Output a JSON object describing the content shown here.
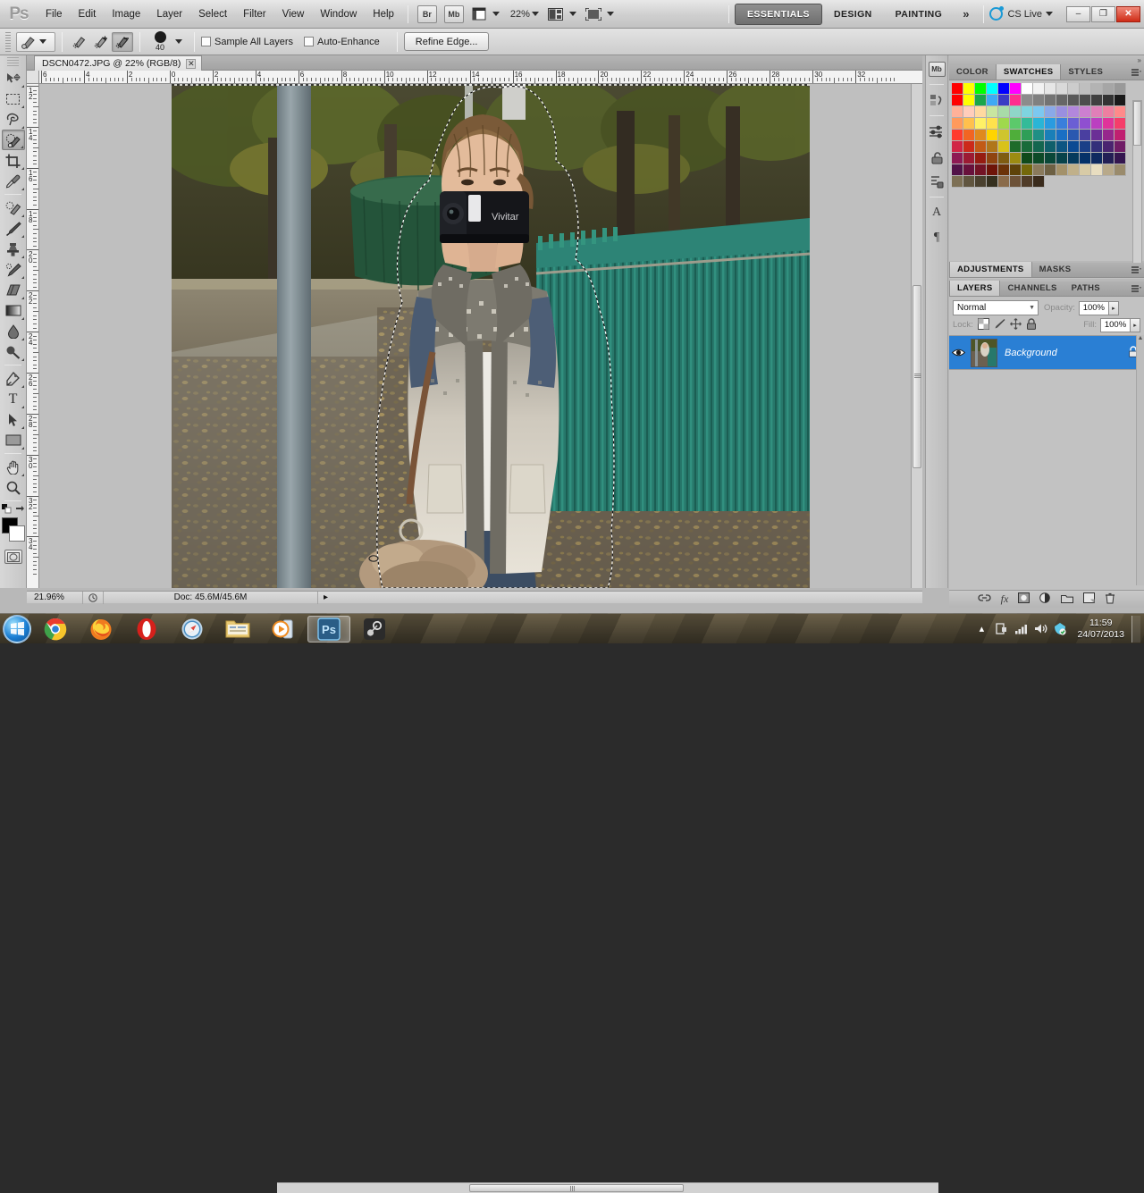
{
  "app": {
    "name": "Adobe Photoshop CS5",
    "logo": "Ps"
  },
  "menubar": {
    "items": [
      "File",
      "Edit",
      "Image",
      "Layer",
      "Select",
      "Filter",
      "View",
      "Window",
      "Help"
    ],
    "bridge_label": "Br",
    "minibridge_label": "Mb",
    "zoom_level": "22%",
    "workspaces": [
      "ESSENTIALS",
      "DESIGN",
      "PAINTING"
    ],
    "workspace_active": "ESSENTIALS",
    "more_workspaces": "»",
    "cs_live": "CS Live",
    "window_buttons": {
      "minimize": "–",
      "restore": "❐",
      "close": "✕"
    }
  },
  "options_bar": {
    "tool": "Quick Selection Tool",
    "modes": [
      "new-selection",
      "add-to-selection",
      "subtract-from-selection"
    ],
    "mode_active": "subtract-from-selection",
    "brush_size": "40",
    "sample_all_layers": "Sample All Layers",
    "sample_all_layers_checked": false,
    "auto_enhance": "Auto-Enhance",
    "auto_enhance_checked": false,
    "refine_edge": "Refine Edge..."
  },
  "toolbar": {
    "tools": [
      {
        "name": "move-tool",
        "glyph": "✤"
      },
      {
        "name": "rectangular-marquee-tool",
        "glyph": "⬚"
      },
      {
        "name": "lasso-tool",
        "glyph": "❂"
      },
      {
        "name": "quick-selection-tool",
        "glyph": "✎",
        "active": true
      },
      {
        "name": "crop-tool",
        "glyph": "⌗"
      },
      {
        "name": "eyedropper-tool",
        "glyph": "✒"
      },
      {
        "name": "spot-healing-brush-tool",
        "glyph": "❁"
      },
      {
        "name": "brush-tool",
        "glyph": "✐"
      },
      {
        "name": "clone-stamp-tool",
        "glyph": "⚑"
      },
      {
        "name": "history-brush-tool",
        "glyph": "✒"
      },
      {
        "name": "eraser-tool",
        "glyph": "▭"
      },
      {
        "name": "gradient-tool",
        "glyph": "▤"
      },
      {
        "name": "blur-tool",
        "glyph": "●"
      },
      {
        "name": "dodge-tool",
        "glyph": "⚲"
      },
      {
        "name": "pen-tool",
        "glyph": "✒"
      },
      {
        "name": "horizontal-type-tool",
        "glyph": "T"
      },
      {
        "name": "path-selection-tool",
        "glyph": "➤"
      },
      {
        "name": "rectangle-tool",
        "glyph": "▬"
      },
      {
        "name": "hand-tool",
        "glyph": "✋"
      },
      {
        "name": "zoom-tool",
        "glyph": "⌕"
      }
    ],
    "foreground_color": "#000000",
    "background_color": "#ffffff"
  },
  "document": {
    "tab_title": "DSCN0472.JPG @ 22% (RGB/8)",
    "close_glyph": "✕",
    "h_ruler_labels": [
      "6",
      "4",
      "2",
      "0",
      "2",
      "4",
      "6",
      "8",
      "10",
      "12",
      "14",
      "16",
      "18",
      "20",
      "22",
      "24",
      "26",
      "28",
      "30",
      "32"
    ],
    "v_ruler_labels": [
      "12",
      "14",
      "16",
      "18",
      "20",
      "22",
      "24",
      "26",
      "28",
      "30",
      "32",
      "34"
    ],
    "selection_active": true,
    "image_description": "Young woman holding a Vivitar camcorder to her face, standing on a leaf-covered park path beside a green metal fence"
  },
  "status_bar": {
    "zoom": "21.96%",
    "doc_size": "Doc: 45.6M/45.6M",
    "arrow": "▸"
  },
  "icon_dock": [
    {
      "name": "mini-bridge-icon",
      "glyph": "Mb"
    },
    {
      "name": "history-icon",
      "glyph": "↺"
    },
    {
      "name": "adjustments-icon",
      "glyph": "☲"
    },
    {
      "name": "masks-icon",
      "glyph": "⚑"
    },
    {
      "name": "styles-icon",
      "glyph": "≡"
    },
    {
      "name": "character-icon",
      "glyph": "A"
    },
    {
      "name": "paragraph-icon",
      "glyph": "¶"
    }
  ],
  "swatches_panel": {
    "tabs": [
      "COLOR",
      "SWATCHES",
      "STYLES"
    ],
    "active_tab": "SWATCHES",
    "colors": [
      "#ff0000",
      "#ffff00",
      "#00ff00",
      "#00ffff",
      "#0000ff",
      "#ff00ff",
      "#ffffff",
      "#f2f2f2",
      "#e6e6e6",
      "#d9d9d9",
      "#cccccc",
      "#bfbfbf",
      "#b3b3b3",
      "#a6a6a6",
      "#999999",
      "#ff0000",
      "#ffff00",
      "#1aa64b",
      "#3fa9f5",
      "#3b3bc4",
      "#ff2d8f",
      "#8c8c8c",
      "#808080",
      "#737373",
      "#666666",
      "#595959",
      "#4d4d4d",
      "#404040",
      "#333333",
      "#1a1a1a",
      "#ffb199",
      "#ffcdbb",
      "#ffd9a0",
      "#c8e6a0",
      "#a8dba8",
      "#8fd6c8",
      "#7fd4e0",
      "#7cc8f0",
      "#8aa9e8",
      "#9a8fe0",
      "#b287dc",
      "#cc7fd0",
      "#e07fb8",
      "#ee7fa0",
      "#ff8a8a",
      "#ff9a5c",
      "#ffc04d",
      "#fff066",
      "#ffe14d",
      "#9fd94d",
      "#5cc96b",
      "#33bb99",
      "#2ab5d6",
      "#2a9be0",
      "#3a7fdc",
      "#6b5fd4",
      "#8f4fd0",
      "#bb3fc0",
      "#e0339a",
      "#f53d6a",
      "#ff3b2e",
      "#f26522",
      "#e08a1e",
      "#ffd400",
      "#cfc52e",
      "#4fae3a",
      "#2e9e57",
      "#1f8f85",
      "#1a7fb8",
      "#1a6fc4",
      "#2a58b0",
      "#4a3fa0",
      "#6b2f96",
      "#96278c",
      "#c01f70",
      "#d12545",
      "#cc2a1a",
      "#c25a16",
      "#b0761a",
      "#d9c21a",
      "#1f6b2a",
      "#196b3a",
      "#14664f",
      "#0f5f6b",
      "#0d5582",
      "#0c4a93",
      "#1a3f87",
      "#33307a",
      "#4a2470",
      "#701c66",
      "#8e1a54",
      "#9c1a33",
      "#961c11",
      "#8f4410",
      "#7f5c12",
      "#9c8c12",
      "#0f4a1a",
      "#0d4a28",
      "#0a4738",
      "#07424a",
      "#063a5c",
      "#053268",
      "#0f2a60",
      "#231f55",
      "#34164f",
      "#521348",
      "#68113c",
      "#731325",
      "#6e1409",
      "#6b3208",
      "#5e430a",
      "#74680a",
      "#8a7a5c",
      "#6d6043",
      "#a3916a",
      "#c0b08a",
      "#d8cba6",
      "#e8ddc0",
      "#b8a98a",
      "#9a8b6c",
      "#7d7055",
      "#60553f",
      "#4a412f",
      "#35301f",
      "#8a6b4a",
      "#6d5238",
      "#503c28",
      "#3a2b1c"
    ]
  },
  "adjustments_panel": {
    "tabs": [
      "ADJUSTMENTS",
      "MASKS"
    ],
    "active_tab": "ADJUSTMENTS"
  },
  "layers_panel": {
    "tabs": [
      "LAYERS",
      "CHANNELS",
      "PATHS"
    ],
    "active_tab": "LAYERS",
    "blend_mode": "Normal",
    "opacity_label": "Opacity:",
    "opacity_value": "100%",
    "lock_label": "Lock:",
    "fill_label": "Fill:",
    "fill_value": "100%",
    "lock_icons": [
      "lock-transparent-pixels-icon",
      "lock-image-pixels-icon",
      "lock-position-icon",
      "lock-all-icon"
    ],
    "layers": [
      {
        "name": "Background",
        "visible": true,
        "locked": true,
        "selected": true
      }
    ],
    "bottom_buttons": [
      {
        "name": "link-layers-button",
        "glyph": "∞"
      },
      {
        "name": "layer-style-button",
        "glyph": "fx"
      },
      {
        "name": "layer-mask-button",
        "glyph": "▣"
      },
      {
        "name": "adjustment-layer-button",
        "glyph": "◐"
      },
      {
        "name": "new-group-button",
        "glyph": "▭"
      },
      {
        "name": "new-layer-button",
        "glyph": "⧉"
      },
      {
        "name": "delete-layer-button",
        "glyph": "Ὕ1"
      }
    ]
  },
  "taskbar": {
    "start_glyph": "⊞",
    "apps": [
      {
        "name": "google-chrome",
        "glyph": "chrome"
      },
      {
        "name": "mozilla-firefox",
        "glyph": "firefox"
      },
      {
        "name": "opera",
        "glyph": "opera"
      },
      {
        "name": "safari",
        "glyph": "safari"
      },
      {
        "name": "windows-explorer",
        "glyph": "explorer"
      },
      {
        "name": "windows-media-player",
        "glyph": "wmp"
      },
      {
        "name": "adobe-photoshop",
        "glyph": "Ps",
        "active": true
      },
      {
        "name": "steam",
        "glyph": "steam"
      }
    ],
    "tray": {
      "show_hidden": "▴",
      "icons": [
        "action-center-icon",
        "network-icon",
        "volume-icon",
        "antivirus-icon"
      ],
      "time": "11:59",
      "date": "24/07/2013"
    }
  }
}
